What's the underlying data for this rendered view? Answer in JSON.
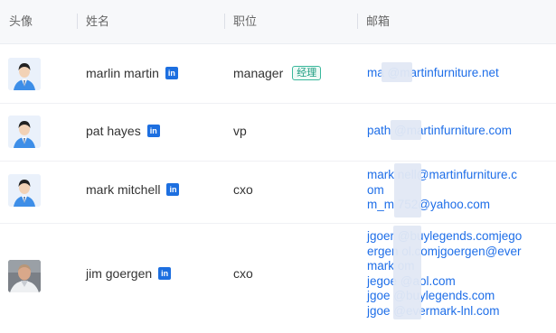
{
  "headers": {
    "avatar": "头像",
    "name": "姓名",
    "position": "职位",
    "email": "邮箱"
  },
  "linkedin_label": "in",
  "colors": {
    "link": "#1e6ee8",
    "tag_green": "#1f9d82",
    "linkedin": "#1d6fe0"
  },
  "rows": [
    {
      "avatar": "default-avatar-icon",
      "name": "marlin martin",
      "position": "manager",
      "tag": "经理",
      "emails": [
        "ma          @martinfurniture.net"
      ]
    },
    {
      "avatar": "default-avatar-icon",
      "name": "pat hayes",
      "position": "vp",
      "emails": [
        "path         @martinfurniture.com"
      ]
    },
    {
      "avatar": "default-avatar-icon",
      "name": "mark mitchell",
      "position": "cxo",
      "emails": [
        "mark       nell@martinfurniture.c",
        "om",
        "m_m       752@yahoo.com"
      ]
    },
    {
      "avatar": "photo-avatar",
      "name": "jim goergen",
      "position": "cxo",
      "emails": [
        "jgoer       @buylegends.comjego",
        "ergen       ol.comjgoergen@ever",
        "mark        om",
        "jegoe       @aol.com",
        "jgoe        @buylegends.com",
        "jgoe        @evermark-lnl.com"
      ]
    }
  ]
}
